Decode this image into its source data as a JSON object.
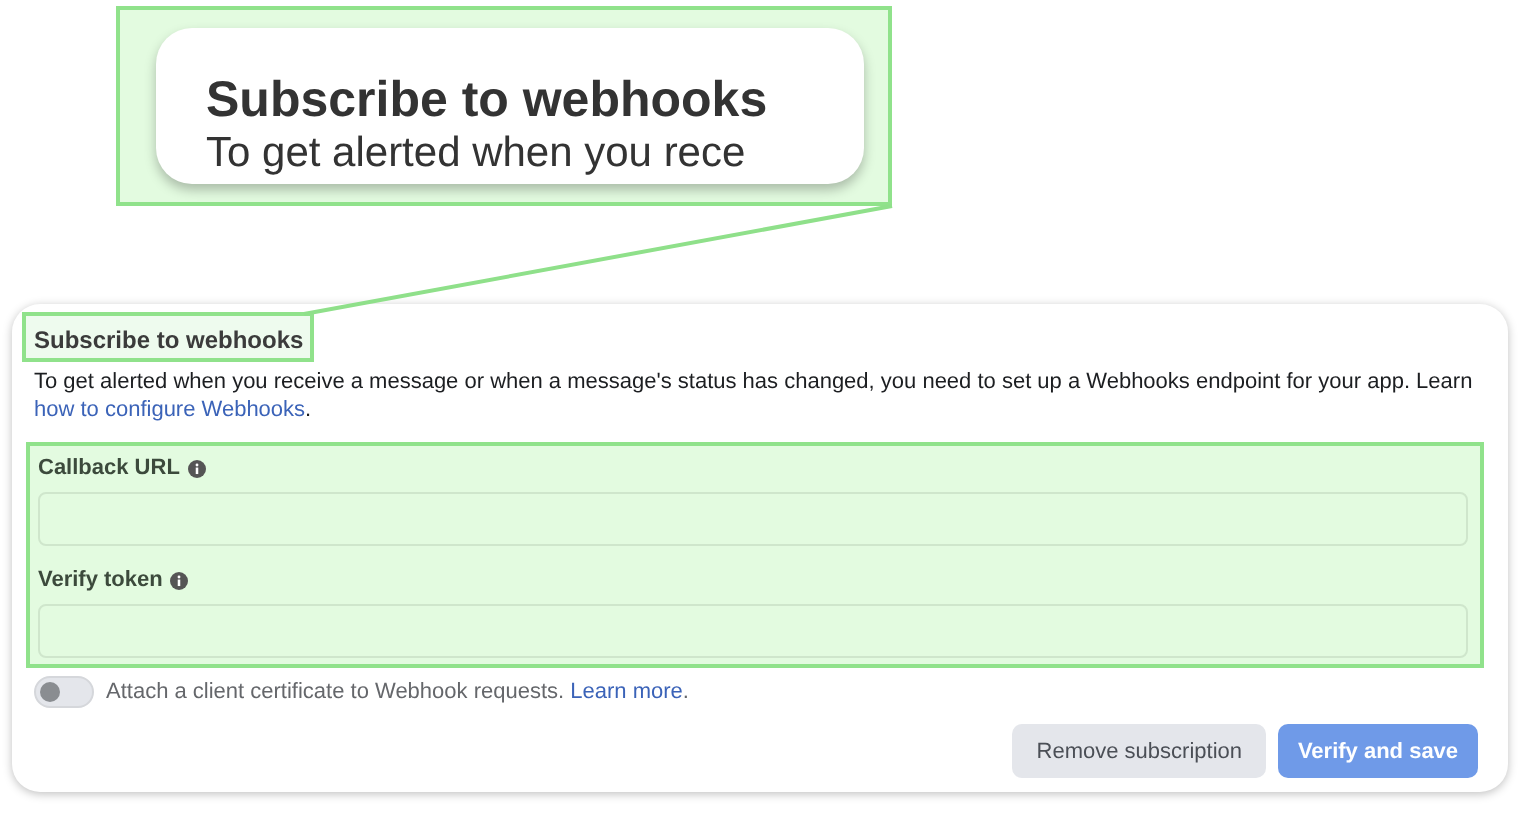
{
  "callout": {
    "title": "Subscribe to webhooks",
    "text": "To get alerted when you rece"
  },
  "section": {
    "title": "Subscribe to webhooks",
    "description": "To get alerted when you receive a message or when a message's status has changed, you need to set up a Webhooks endpoint for your app. Learn ",
    "link": "how to configure Webhooks",
    "link_suffix": "."
  },
  "fields": [
    {
      "label": "Callback URL"
    },
    {
      "label": "Verify token"
    }
  ],
  "toggle": {
    "on": false,
    "label": "Attach a client certificate to Webhook requests. ",
    "link": "Learn more",
    "link_suffix": "."
  },
  "buttons": [
    {
      "label": "Remove subscription",
      "kind": "secondary",
      "disabled": false
    },
    {
      "label": "Verify and save",
      "kind": "primary",
      "disabled": true
    }
  ]
}
